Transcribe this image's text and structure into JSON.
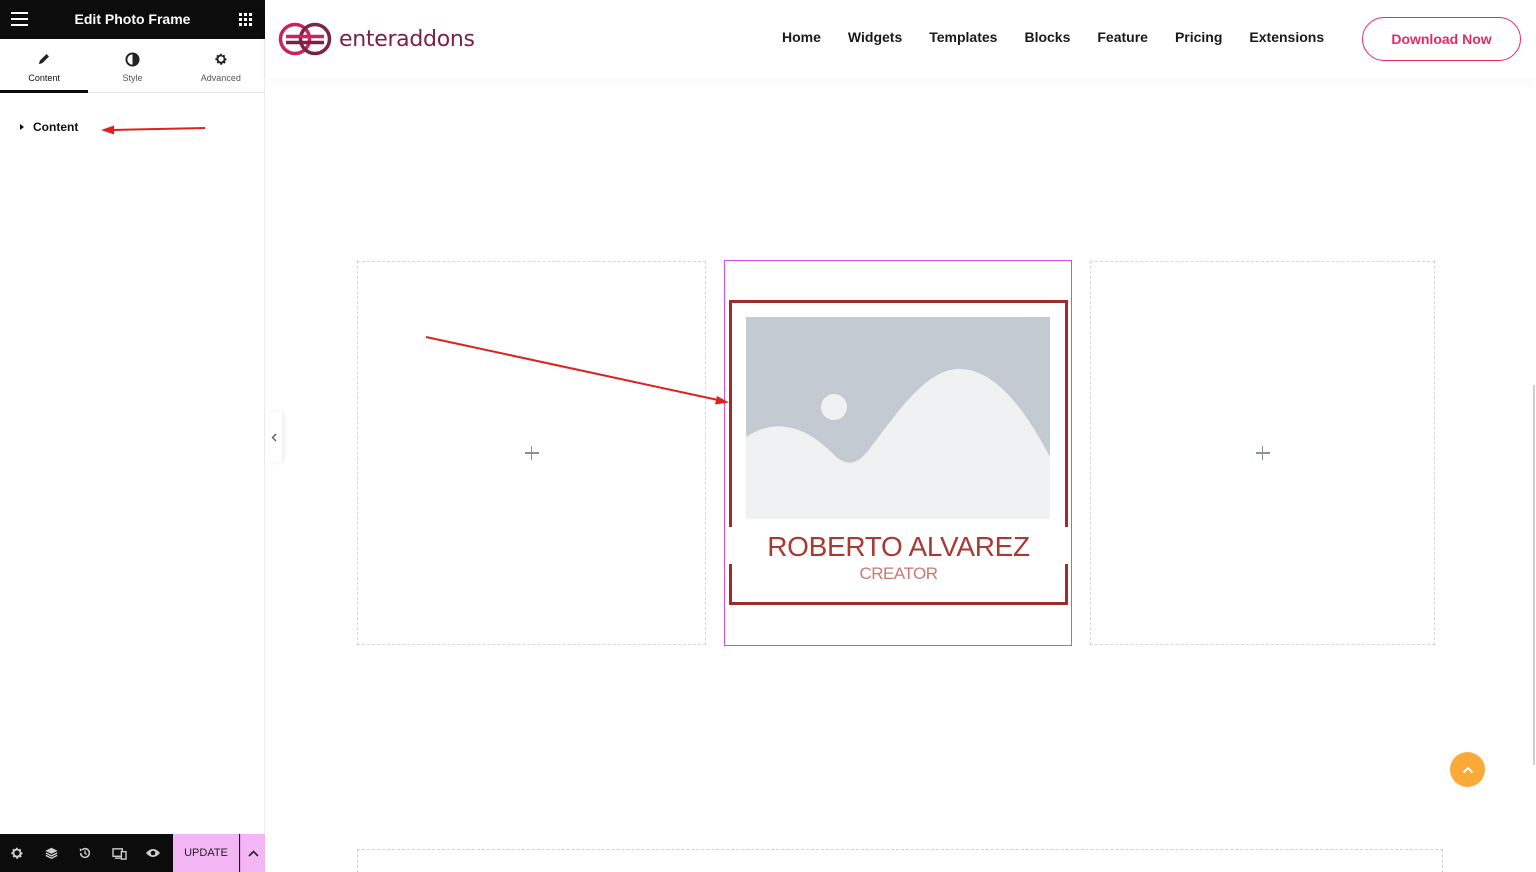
{
  "panel": {
    "title": "Edit Photo Frame",
    "tabs": [
      {
        "label": "Content",
        "icon": "pencil-icon"
      },
      {
        "label": "Style",
        "icon": "contrast-icon"
      },
      {
        "label": "Advanced",
        "icon": "gear-icon"
      }
    ],
    "section_label": "Content",
    "footer": {
      "icons": [
        "gear-icon",
        "layers-icon",
        "history-icon",
        "responsive-icon",
        "eye-icon"
      ],
      "update_label": "UPDATE"
    }
  },
  "site": {
    "logo_text": "enteraddons",
    "nav": [
      "Home",
      "Widgets",
      "Templates",
      "Blocks",
      "Feature",
      "Pricing",
      "Extensions"
    ],
    "cta_label": "Download Now"
  },
  "widget": {
    "name": "ROBERTO ALVAREZ",
    "role": "CREATOR"
  },
  "colors": {
    "frame": "#9b2d2a",
    "brand": "#e22c62",
    "selection": "#d64be0",
    "update": "#f3b6f5",
    "back_to_top": "#fbaa3a",
    "annotation": "#e02020"
  }
}
